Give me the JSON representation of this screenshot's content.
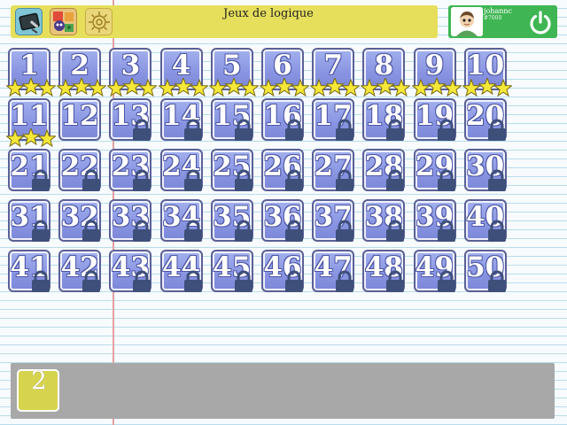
{
  "app": {
    "title": "Jeux de logique"
  },
  "toolbar": {
    "buttons": [
      {
        "name": "chalkboard-icon"
      },
      {
        "name": "games-icon"
      },
      {
        "name": "settings-icon"
      }
    ]
  },
  "user": {
    "name": "johannc",
    "id": "#7000",
    "avatar": "avatar-icon",
    "logout_icon": "power-icon"
  },
  "levels": [
    {
      "number": "1",
      "stars": 3,
      "locked": false
    },
    {
      "number": "2",
      "stars": 3,
      "locked": false
    },
    {
      "number": "3",
      "stars": 3,
      "locked": false
    },
    {
      "number": "4",
      "stars": 3,
      "locked": false
    },
    {
      "number": "5",
      "stars": 3,
      "locked": false
    },
    {
      "number": "6",
      "stars": 3,
      "locked": false
    },
    {
      "number": "7",
      "stars": 3,
      "locked": false
    },
    {
      "number": "8",
      "stars": 3,
      "locked": false
    },
    {
      "number": "9",
      "stars": 3,
      "locked": false
    },
    {
      "number": "10",
      "stars": 3,
      "locked": false
    },
    {
      "number": "11",
      "stars": 3,
      "locked": false
    },
    {
      "number": "12",
      "stars": 0,
      "locked": false
    },
    {
      "number": "13",
      "stars": 0,
      "locked": true
    },
    {
      "number": "14",
      "stars": 0,
      "locked": true
    },
    {
      "number": "15",
      "stars": 0,
      "locked": true
    },
    {
      "number": "16",
      "stars": 0,
      "locked": true
    },
    {
      "number": "17",
      "stars": 0,
      "locked": true
    },
    {
      "number": "18",
      "stars": 0,
      "locked": true
    },
    {
      "number": "19",
      "stars": 0,
      "locked": true
    },
    {
      "number": "20",
      "stars": 0,
      "locked": true
    },
    {
      "number": "21",
      "stars": 0,
      "locked": true
    },
    {
      "number": "22",
      "stars": 0,
      "locked": true
    },
    {
      "number": "23",
      "stars": 0,
      "locked": true
    },
    {
      "number": "24",
      "stars": 0,
      "locked": true
    },
    {
      "number": "25",
      "stars": 0,
      "locked": true
    },
    {
      "number": "26",
      "stars": 0,
      "locked": true
    },
    {
      "number": "27",
      "stars": 0,
      "locked": true
    },
    {
      "number": "28",
      "stars": 0,
      "locked": true
    },
    {
      "number": "29",
      "stars": 0,
      "locked": true
    },
    {
      "number": "30",
      "stars": 0,
      "locked": true
    },
    {
      "number": "31",
      "stars": 0,
      "locked": true
    },
    {
      "number": "32",
      "stars": 0,
      "locked": true
    },
    {
      "number": "33",
      "stars": 0,
      "locked": true
    },
    {
      "number": "34",
      "stars": 0,
      "locked": true
    },
    {
      "number": "35",
      "stars": 0,
      "locked": true
    },
    {
      "number": "36",
      "stars": 0,
      "locked": true
    },
    {
      "number": "37",
      "stars": 0,
      "locked": true
    },
    {
      "number": "38",
      "stars": 0,
      "locked": true
    },
    {
      "number": "39",
      "stars": 0,
      "locked": true
    },
    {
      "number": "40",
      "stars": 0,
      "locked": true
    },
    {
      "number": "41",
      "stars": 0,
      "locked": true
    },
    {
      "number": "42",
      "stars": 0,
      "locked": true
    },
    {
      "number": "43",
      "stars": 0,
      "locked": true
    },
    {
      "number": "44",
      "stars": 0,
      "locked": true
    },
    {
      "number": "45",
      "stars": 0,
      "locked": true
    },
    {
      "number": "46",
      "stars": 0,
      "locked": true
    },
    {
      "number": "47",
      "stars": 0,
      "locked": true
    },
    {
      "number": "48",
      "stars": 0,
      "locked": true
    },
    {
      "number": "49",
      "stars": 0,
      "locked": true
    },
    {
      "number": "50",
      "stars": 0,
      "locked": true
    }
  ],
  "tray": {
    "card_value": "2"
  },
  "colors": {
    "topbar": "#e6df5c",
    "userpanel": "#3fb653",
    "tile": "#8a96e2",
    "star": "#f5e83a",
    "lock": "#3e4f7a",
    "tray": "#a8a8a8",
    "tray_card": "#d6d34e"
  }
}
